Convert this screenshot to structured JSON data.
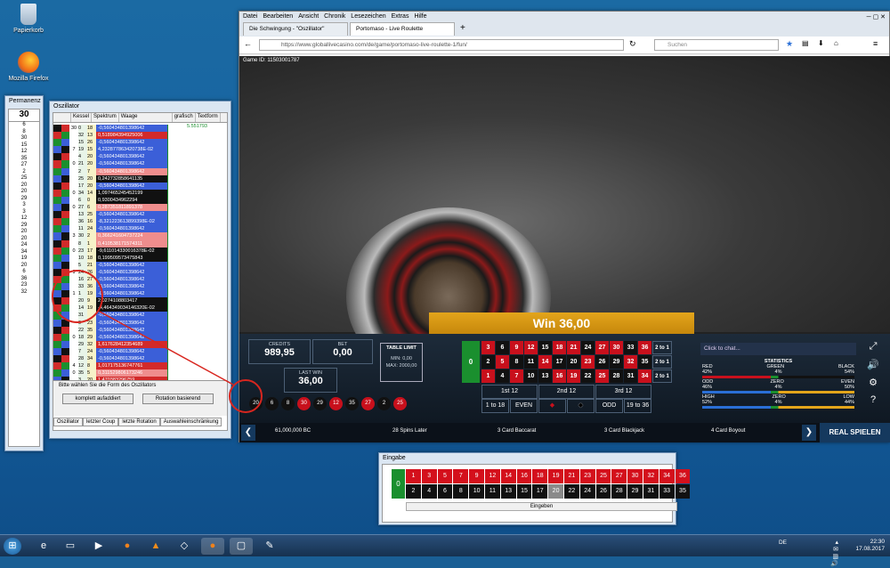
{
  "desktop": {
    "icons": [
      {
        "label": "Papierkorb",
        "icon": "recycle-bin-icon"
      },
      {
        "label": "Mozilla Firefox",
        "icon": "firefox-icon"
      }
    ]
  },
  "permanenz": {
    "title": "Permanenz",
    "current": "30",
    "numbers": [
      "6",
      "8",
      "30",
      "15",
      "12",
      "35",
      "27",
      "2",
      "25",
      "20",
      "20",
      "29",
      "3",
      "3",
      "12",
      "29",
      "20",
      "20",
      "24",
      "34",
      "19",
      "20",
      "6",
      "36",
      "23",
      "32"
    ]
  },
  "oszillator": {
    "title": "Oszillator",
    "headers": [
      "Kessel",
      "Spektrum",
      "Waage",
      "grafisch",
      "Textform"
    ],
    "top_value": "5.551793",
    "rows": [
      {
        "a": "30",
        "b": "0",
        "c": "18",
        "val": "-0,560434801398642",
        "color": "#3b5fd8"
      },
      {
        "a": "",
        "b": "32",
        "c": "13",
        "val": "0,518984394925006",
        "color": "#d22a2a"
      },
      {
        "a": "",
        "b": "15",
        "c": "26",
        "val": "-0,560434801398642",
        "color": "#3b5fd8"
      },
      {
        "a": "7",
        "b": "19",
        "c": "15",
        "val": "4,232877863420738E-02",
        "color": "#3b5fd8"
      },
      {
        "a": "",
        "b": "4",
        "c": "20",
        "val": "-0,560434801398642",
        "color": "#3b5fd8"
      },
      {
        "a": "0",
        "b": "21",
        "c": "20",
        "val": "-0,560434801398642",
        "color": "#3b5fd8"
      },
      {
        "a": "",
        "b": "2",
        "c": "7",
        "val": "-0,560434801398642",
        "color": "#ef8d8d"
      },
      {
        "a": "",
        "b": "25",
        "c": "20",
        "val": "0,242732858641135",
        "color": "#111"
      },
      {
        "a": "",
        "b": "17",
        "c": "20",
        "val": "-0,560434801398642",
        "color": "#3b5fd8"
      },
      {
        "a": "0",
        "b": "34",
        "c": "14",
        "val": "1,097465245452199",
        "color": "#111"
      },
      {
        "a": "",
        "b": "6",
        "c": "0",
        "val": "0,9300434962294",
        "color": "#111"
      },
      {
        "a": "0",
        "b": "27",
        "c": "6",
        "val": "0,287351811891378",
        "color": "#ef8d8d"
      },
      {
        "a": "",
        "b": "13",
        "c": "25",
        "val": "-0,560434801398642",
        "color": "#3b5fd8"
      },
      {
        "a": "",
        "b": "36",
        "c": "16",
        "val": "-8,321223613899398E-02",
        "color": "#3b5fd8"
      },
      {
        "a": "",
        "b": "11",
        "c": "24",
        "val": "-0,560434801398642",
        "color": "#3b5fd8"
      },
      {
        "a": "3",
        "b": "30",
        "c": "2",
        "val": "0,366241604737224",
        "color": "#ef8d8d"
      },
      {
        "a": "",
        "b": "8",
        "c": "1",
        "val": "0,410538171574311",
        "color": "#ef8d8d"
      },
      {
        "a": "0",
        "b": "23",
        "c": "17",
        "val": "-9,611014330016378E-02",
        "color": "#111"
      },
      {
        "a": "",
        "b": "10",
        "c": "18",
        "val": "0,199509573475843",
        "color": "#111"
      },
      {
        "a": "",
        "b": "5",
        "c": "21",
        "val": "-0,560434801398642",
        "color": "#3b5fd8"
      },
      {
        "a": "9",
        "b": "24",
        "c": "26",
        "val": "-0,560434801398642",
        "color": "#3b5fd8"
      },
      {
        "a": "",
        "b": "16",
        "c": "27",
        "val": "-0,560434801398642",
        "color": "#3b5fd8"
      },
      {
        "a": "",
        "b": "33",
        "c": "36",
        "val": "-0,560434801398642",
        "color": "#3b5fd8"
      },
      {
        "a": "1",
        "b": "1",
        "c": "19",
        "val": "-0,560434801398642",
        "color": "#3b5fd8"
      },
      {
        "a": "",
        "b": "20",
        "c": "9",
        "val": "2,0274108803417",
        "color": "#111"
      },
      {
        "a": "",
        "b": "14",
        "c": "19",
        "val": "-4,464349034146320E-02",
        "color": "#111"
      },
      {
        "a": "",
        "b": "31",
        "c": "",
        "val": "-0,560434801398642",
        "color": "#3b5fd8"
      },
      {
        "a": "",
        "b": "9",
        "c": "23",
        "val": "-0,560434801398642",
        "color": "#3b5fd8"
      },
      {
        "a": "",
        "b": "22",
        "c": "35",
        "val": "-0,560434801398642",
        "color": "#3b5fd8"
      },
      {
        "a": "0",
        "b": "18",
        "c": "29",
        "val": "-0,560434801398642",
        "color": "#3b5fd8"
      },
      {
        "a": "",
        "b": "29",
        "c": "32",
        "val": "1,617628412354689",
        "color": "#d22a2a"
      },
      {
        "a": "",
        "b": "7",
        "c": "24",
        "val": "-0,560434801398642",
        "color": "#3b5fd8"
      },
      {
        "a": "",
        "b": "28",
        "c": "34",
        "val": "-0,560434801398642",
        "color": "#3b5fd8"
      },
      {
        "a": "4",
        "b": "12",
        "c": "8",
        "val": "1,017175136747761",
        "color": "#d22a2a"
      },
      {
        "a": "0",
        "b": "35",
        "c": "5",
        "val": "0,311529806173246",
        "color": "#ef8d8d"
      },
      {
        "a": "",
        "b": "3",
        "c": "20",
        "val": "1,470383296759",
        "color": "#d22a2a"
      },
      {
        "a": "",
        "b": "26",
        "c": "33",
        "val": "-0,560434801398642",
        "color": "#3b5fd8"
      }
    ],
    "form_label": "Bitte wählen Sie die Form des Oszillators",
    "btn_left": "komplett aufaddiert",
    "btn_right": "Rotation basierend",
    "tabs": [
      "Oszillator",
      "letzter Coup",
      "letzte Rotation",
      "Auswahleinschränkung"
    ]
  },
  "browser": {
    "menu": [
      "Datei",
      "Bearbeiten",
      "Ansicht",
      "Chronik",
      "Lesezeichen",
      "Extras",
      "Hilfe"
    ],
    "tabs": [
      "Die Schwingung - \"Oszillator\"",
      "Portomaso - Live Roulette"
    ],
    "url": "https://www.globallivecasino.com/de/game/portomaso-live-roulette-1/fun/",
    "search_placeholder": "Suchen"
  },
  "game": {
    "game_id": "Game ID: 11503001787",
    "win_text": "Win 36,00",
    "credits_label": "CREDITS",
    "credits": "989,95",
    "bet_label": "BET",
    "bet": "0,00",
    "lastwin_label": "LAST WIN",
    "lastwin": "36,00",
    "limit_title": "TABLE LIMIT",
    "limit_min": "MIN: 0,00",
    "limit_max": "MAX: 2000,00",
    "history": [
      {
        "n": "20",
        "c": "#111"
      },
      {
        "n": "6",
        "c": "#111"
      },
      {
        "n": "8",
        "c": "#111"
      },
      {
        "n": "30",
        "c": "#c8101c"
      },
      {
        "n": "29",
        "c": "#111"
      },
      {
        "n": "12",
        "c": "#c8101c"
      },
      {
        "n": "35",
        "c": "#111"
      },
      {
        "n": "27",
        "c": "#c8101c"
      },
      {
        "n": "2",
        "c": "#111"
      },
      {
        "n": "25",
        "c": "#c8101c"
      }
    ],
    "table_rows": [
      [
        "3",
        "6",
        "9",
        "12",
        "15",
        "18",
        "21",
        "24",
        "27",
        "30",
        "33",
        "36",
        "2 to 1"
      ],
      [
        "2",
        "5",
        "8",
        "11",
        "14",
        "17",
        "20",
        "23",
        "26",
        "29",
        "32",
        "35",
        "2 to 1"
      ],
      [
        "1",
        "4",
        "7",
        "10",
        "13",
        "16",
        "19",
        "22",
        "25",
        "28",
        "31",
        "34",
        "2 to 1"
      ]
    ],
    "dozens": [
      "1st 12",
      "2nd 12",
      "3rd 12"
    ],
    "outside": [
      "1 to 18",
      "EVEN",
      "",
      "",
      "ODD",
      "19 to 36"
    ],
    "chat": "Click to chat...",
    "stats_title": "STATISTICS",
    "stats": [
      {
        "l": "RED",
        "m": "GREEN",
        "r": "BLACK"
      },
      {
        "l": "42%",
        "m": "4%",
        "r": "54%"
      },
      {
        "l": "ODD",
        "m": "ZERO",
        "r": "EVEN"
      },
      {
        "l": "46%",
        "m": "4%",
        "r": "50%"
      },
      {
        "l": "HIGH",
        "m": "ZERO",
        "r": "LOW"
      },
      {
        "l": "52%",
        "m": "4%",
        "r": "44%"
      }
    ],
    "promos": [
      "61,000,000 BC",
      "28 Spins Later",
      "3 Card Baccarat",
      "3 Card Blackjack",
      "4 Card Boyout"
    ],
    "real_play": "REAL SPIELEN"
  },
  "eingabe": {
    "title": "Eingabe",
    "row1": [
      "1",
      "3",
      "5",
      "7",
      "9",
      "12",
      "14",
      "16",
      "18",
      "19",
      "21",
      "23",
      "25",
      "27",
      "30",
      "32",
      "34",
      "36"
    ],
    "row2": [
      "2",
      "4",
      "6",
      "8",
      "10",
      "11",
      "13",
      "15",
      "17",
      "20",
      "22",
      "24",
      "26",
      "28",
      "29",
      "31",
      "33",
      "35"
    ],
    "button": "Eingeben"
  },
  "taskbar": {
    "lang": "DE",
    "time": "22:30",
    "date": "17.08.2017"
  }
}
